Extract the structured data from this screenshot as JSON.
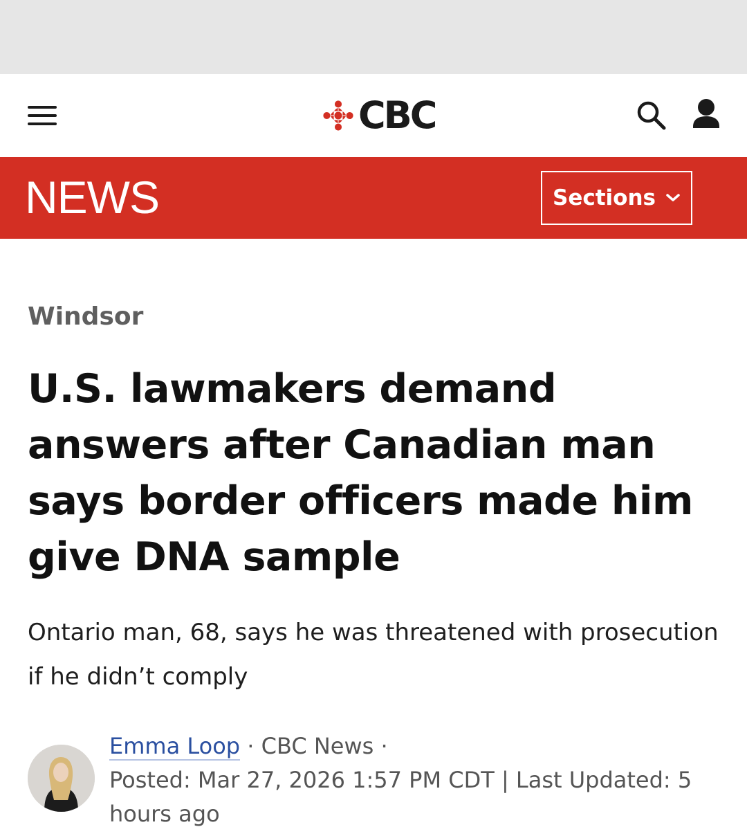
{
  "header": {
    "logo_text": "CBC"
  },
  "news_bar": {
    "title": "NEWS",
    "sections_label": "Sections"
  },
  "article": {
    "location": "Windsor",
    "headline": "U.S. lawmakers demand answers after Canadian man says border officers made him give DNA sample",
    "deck": "Ontario man, 68, says he was threatened with prosecution if he didn’t comply",
    "author": "Emma Loop",
    "sep1": " · ",
    "outlet": "CBC News",
    "sep2": " · ",
    "posted": "Posted: Mar 27, 2026 1:57 PM CDT",
    "divider": " | ",
    "updated": "Last Updated: 5 hours ago"
  },
  "colors": {
    "brand_red": "#d32f23",
    "link_blue": "#2a4fa0"
  },
  "icons": {
    "menu": "hamburger-menu-icon",
    "logo": "cbc-gem-logo",
    "search": "search-icon",
    "account": "user-icon",
    "sections": "chevron-down-icon"
  }
}
